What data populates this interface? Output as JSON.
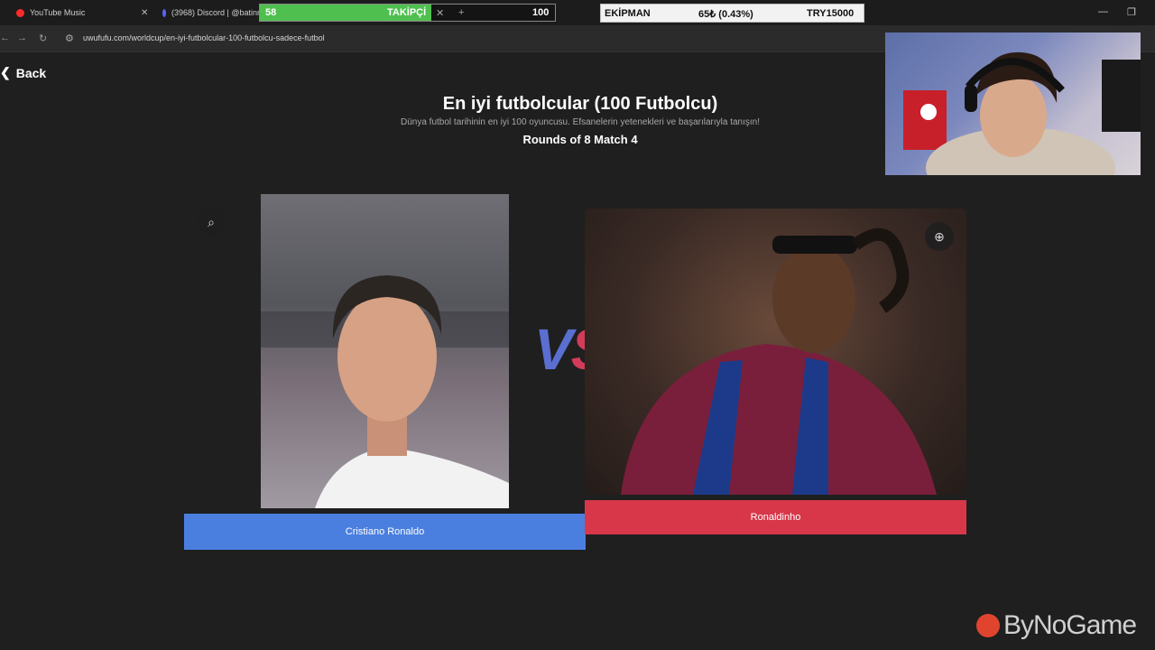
{
  "browser": {
    "tabs": [
      {
        "title": "YouTube Music",
        "color": "#ff2a2a"
      },
      {
        "title": "(3968) Discord | @batinn",
        "color": "#5865f2"
      }
    ],
    "url": "uwufufu.com/worldcup/en-iyi-futbolcular-100-futbolcu-sadece-futbol"
  },
  "overlays": {
    "follow_goal": {
      "current": "58",
      "label": "TAKİPÇİ",
      "target": "100",
      "progress_fraction": 0.58
    },
    "equipment": {
      "label": "EKİPMAN",
      "value": "65₺ (0.43%)",
      "goal": "TRY15000"
    }
  },
  "page": {
    "back_label": "Back",
    "title": "En iyi futbolcular (100 Futbolcu)",
    "subtitle": "Dünya futbol tarihinin en iyi 100 oyuncusu. Efsanelerin yetenekleri ve başarılarıyla tanışın!",
    "rounds": "Rounds of 8 Match 4",
    "vs_left": "V",
    "vs_right": "S",
    "left_choice": "Cristiano Ronaldo",
    "right_choice": "Ronaldinho",
    "left_color": "#4a7fe0",
    "right_color": "#d8374a"
  },
  "watermark": "ByNoGame"
}
